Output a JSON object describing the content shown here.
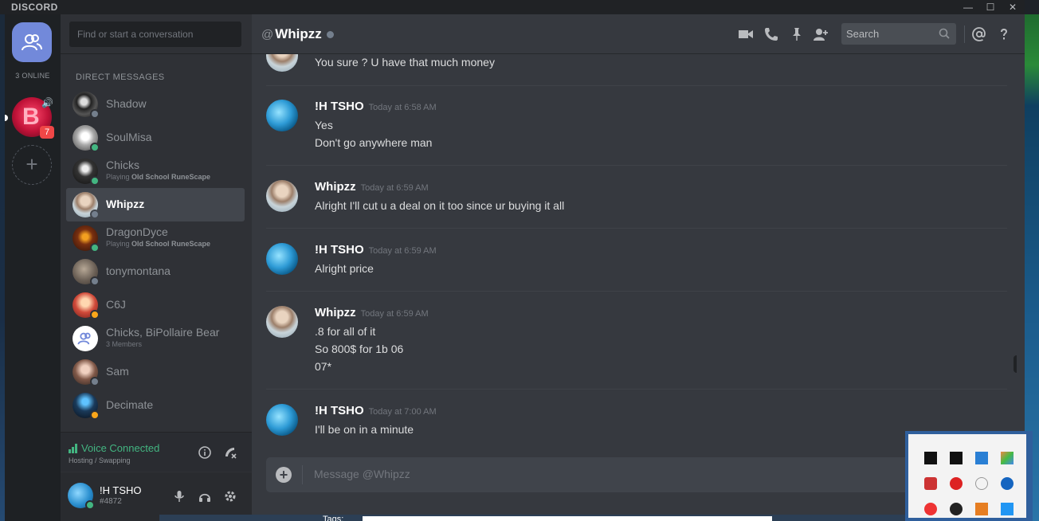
{
  "window": {
    "app_title": "DISCORD",
    "controls": [
      "—",
      "☐",
      "✕"
    ]
  },
  "guilds": {
    "online_count": "3 ONLINE",
    "badge_count": "7"
  },
  "dm_panel": {
    "search_placeholder": "Find or start a conversation",
    "section_header": "DIRECT MESSAGES",
    "items": [
      {
        "name": "Shadow",
        "status": "offline",
        "sub": "",
        "game": ""
      },
      {
        "name": "SoulMisa",
        "status": "online",
        "sub": "",
        "game": ""
      },
      {
        "name": "Chicks",
        "status": "online",
        "sub": "Playing ",
        "game": "Old School RuneScape"
      },
      {
        "name": "Whipzz",
        "status": "offline",
        "sub": "",
        "game": "",
        "active": true
      },
      {
        "name": "DragonDyce",
        "status": "online",
        "sub": "Playing ",
        "game": "Old School RuneScape"
      },
      {
        "name": "tonymontana",
        "status": "offline",
        "sub": "",
        "game": ""
      },
      {
        "name": "C6J",
        "status": "idle",
        "sub": "",
        "game": ""
      },
      {
        "name": "Chicks, BiPollaire Bear",
        "status": "",
        "sub": "3 Members",
        "game": ""
      },
      {
        "name": "Sam",
        "status": "offline",
        "sub": "",
        "game": ""
      },
      {
        "name": "Decimate",
        "status": "idle",
        "sub": "",
        "game": ""
      }
    ],
    "voice": {
      "title": "Voice Connected",
      "channel": "Hosting / Swapping"
    },
    "user": {
      "name": "!H TSHO",
      "tag": "#4872"
    }
  },
  "chat": {
    "at_symbol": "@",
    "channel_name": "Whipzz",
    "search_placeholder": "Search",
    "composer_placeholder": "Message @Whipzz",
    "messages": [
      {
        "author": "",
        "time": "",
        "lines": [
          "You sure ? U have that much money"
        ]
      },
      {
        "author": "!H TSHO",
        "time": "Today at 6:58 AM",
        "lines": [
          "Yes",
          "Don't go anywhere man"
        ]
      },
      {
        "author": "Whipzz",
        "time": "Today at 6:59 AM",
        "lines": [
          "Alright I'll cut u a deal on it too since ur buying it all"
        ]
      },
      {
        "author": "!H TSHO",
        "time": "Today at 6:59 AM",
        "lines": [
          "Alright price"
        ]
      },
      {
        "author": "Whipzz",
        "time": "Today at 6:59 AM",
        "lines": [
          ".8 for all of it",
          "So 800$ for 1b 06",
          "07*"
        ]
      },
      {
        "author": "!H TSHO",
        "time": "Today at 7:00 AM",
        "lines": [
          "I'll be on in a minute"
        ]
      }
    ]
  },
  "desktop": {
    "tags_label": "Tags:"
  },
  "colors": {
    "accent": "#7289da",
    "online": "#43b581",
    "idle": "#faa61a",
    "offline": "#747f8d",
    "alert": "#f04747"
  }
}
